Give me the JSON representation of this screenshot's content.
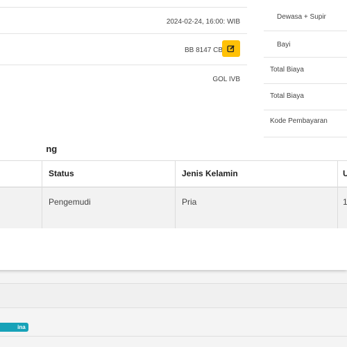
{
  "order_info": {
    "schedule": "2024-02-24, 16:00: WIB",
    "vehicle_plate": "BB 8147 CB",
    "vehicle_class": "GOL IVB"
  },
  "summary": {
    "rows": [
      "Dewasa + Supir",
      "Bayi",
      "Total Biaya",
      "Total Biaya",
      "Kode Pembayaran"
    ]
  },
  "passengers": {
    "section_title": "ng",
    "columns": [
      "Status",
      "Jenis Kelamin",
      "U"
    ],
    "rows": [
      {
        "status": "Pengemudi",
        "gender": "Pria",
        "extra": "1"
      }
    ]
  },
  "badge": {
    "label": "ina"
  },
  "colors": {
    "edit_button": "#ffc107",
    "badge": "#17a2b8"
  },
  "icons": {
    "edit": "edit-icon"
  }
}
